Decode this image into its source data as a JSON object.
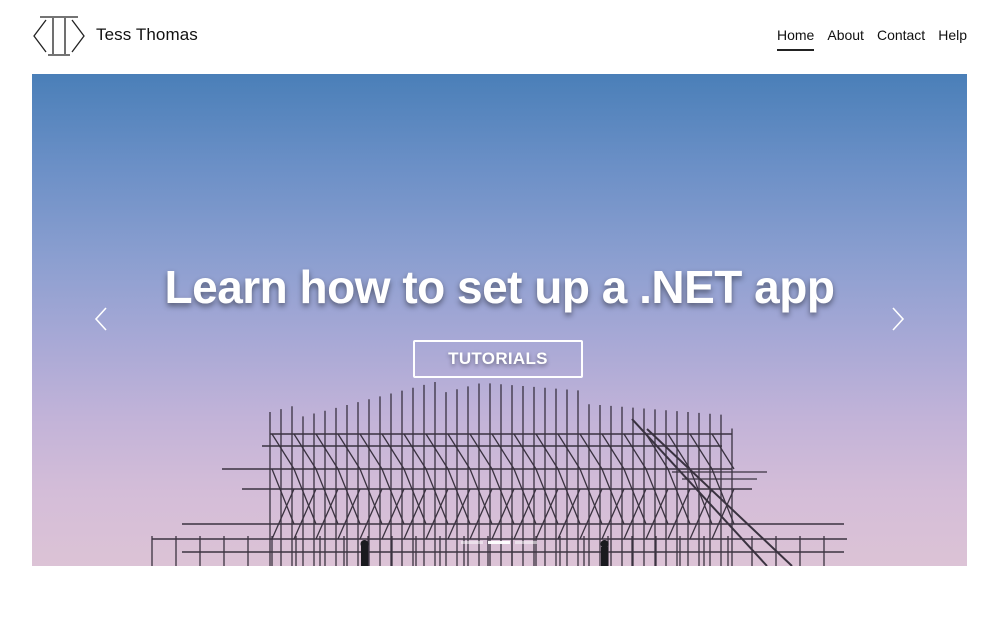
{
  "header": {
    "logo_icon": "brand-logo-icon",
    "site_name": "Tess Thomas",
    "nav": [
      {
        "label": "Home",
        "active": true
      },
      {
        "label": "About",
        "active": false
      },
      {
        "label": "Contact",
        "active": false
      },
      {
        "label": "Help",
        "active": false
      }
    ]
  },
  "carousel": {
    "title": "Learn how to set up a .NET app",
    "button_label": "TUTORIALS",
    "prev_icon": "chevron-left-icon",
    "next_icon": "chevron-right-icon",
    "slide_count": 3,
    "active_slide": 2,
    "sky_colors": [
      "#4a7fb8",
      "#a9a9d6",
      "#dcc3d6"
    ]
  }
}
